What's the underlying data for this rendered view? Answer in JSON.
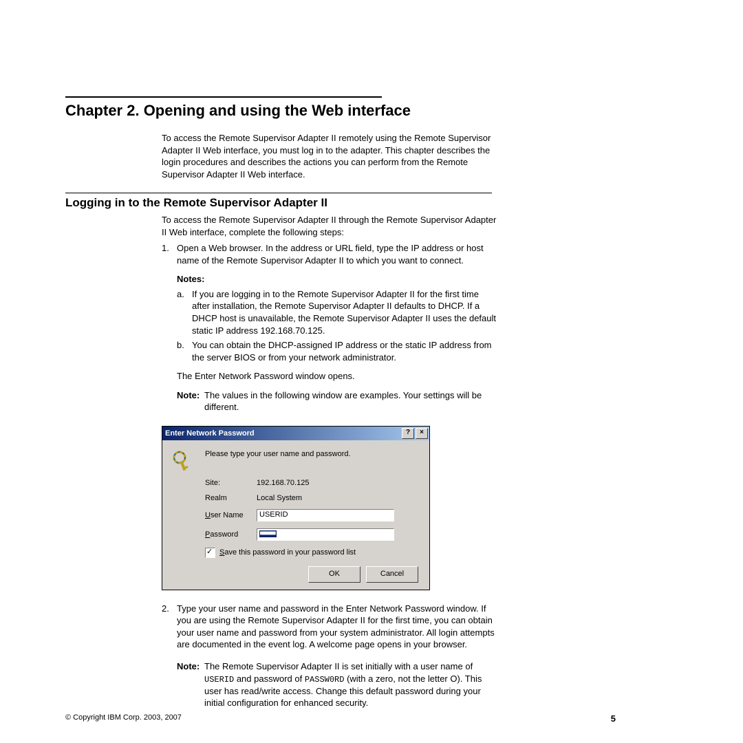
{
  "chapter": {
    "title": "Chapter 2. Opening and using the Web interface",
    "intro": "To access the Remote Supervisor Adapter II remotely using the Remote Supervisor Adapter II Web interface, you must log in to the adapter. This chapter describes the login procedures and describes the actions you can perform from the Remote Supervisor Adapter II Web interface."
  },
  "section": {
    "title": "Logging in to the Remote Supervisor Adapter II",
    "intro": "To access the Remote Supervisor Adapter II through the Remote Supervisor Adapter II Web interface, complete the following steps:",
    "step1": {
      "num": "1.",
      "text": "Open a Web browser. In the address or URL field, type the IP address or host name of the Remote Supervisor Adapter II to which you want to connect.",
      "notes_heading": "Notes:",
      "note_a": {
        "letter": "a.",
        "text": "If you are logging in to the Remote Supervisor Adapter II for the first time after installation, the Remote Supervisor Adapter II defaults to DHCP. If a DHCP host is unavailable, the Remote Supervisor Adapter II uses the default static IP address 192.168.70.125."
      },
      "note_b": {
        "letter": "b.",
        "text": "You can obtain the DHCP-assigned IP address or the static IP address from the server BIOS or from your network administrator."
      },
      "after_notes": "The Enter Network Password window opens.",
      "example_note_label": "Note:",
      "example_note_text": "The values in the following window are examples. Your settings will be different."
    },
    "step2": {
      "num": "2.",
      "text": "Type your user name and password in the Enter Network Password window. If you are using the Remote Supervisor Adapter II for the first time, you can obtain your user name and password from your system administrator. All login attempts are documented in the event log. A welcome page opens in your browser.",
      "note_label": "Note:",
      "note_text_1": "The Remote Supervisor Adapter II is set initially with a user name of ",
      "note_mono_1": "USERID",
      "note_text_2": " and password of ",
      "note_mono_2": "PASSW0RD",
      "note_text_3": " (with a zero, not the letter O). This user has read/write access. Change this default password during your initial configuration for enhanced security."
    }
  },
  "dialog": {
    "title": "Enter Network Password",
    "help_btn": "?",
    "close_btn": "×",
    "prompt": "Please type your user name and password.",
    "site_label": "Site:",
    "site_value": "192.168.70.125",
    "realm_label": "Realm",
    "realm_value": "Local System",
    "username_label": "User Name",
    "username_value": "USERID",
    "password_label": "Password",
    "password_value": "●●●●●●●●",
    "save_checkbox": "Save this password in your password list",
    "ok_btn": "OK",
    "cancel_btn": "Cancel"
  },
  "footer": {
    "copyright": "© Copyright IBM Corp. 2003, 2007",
    "page_num": "5"
  }
}
